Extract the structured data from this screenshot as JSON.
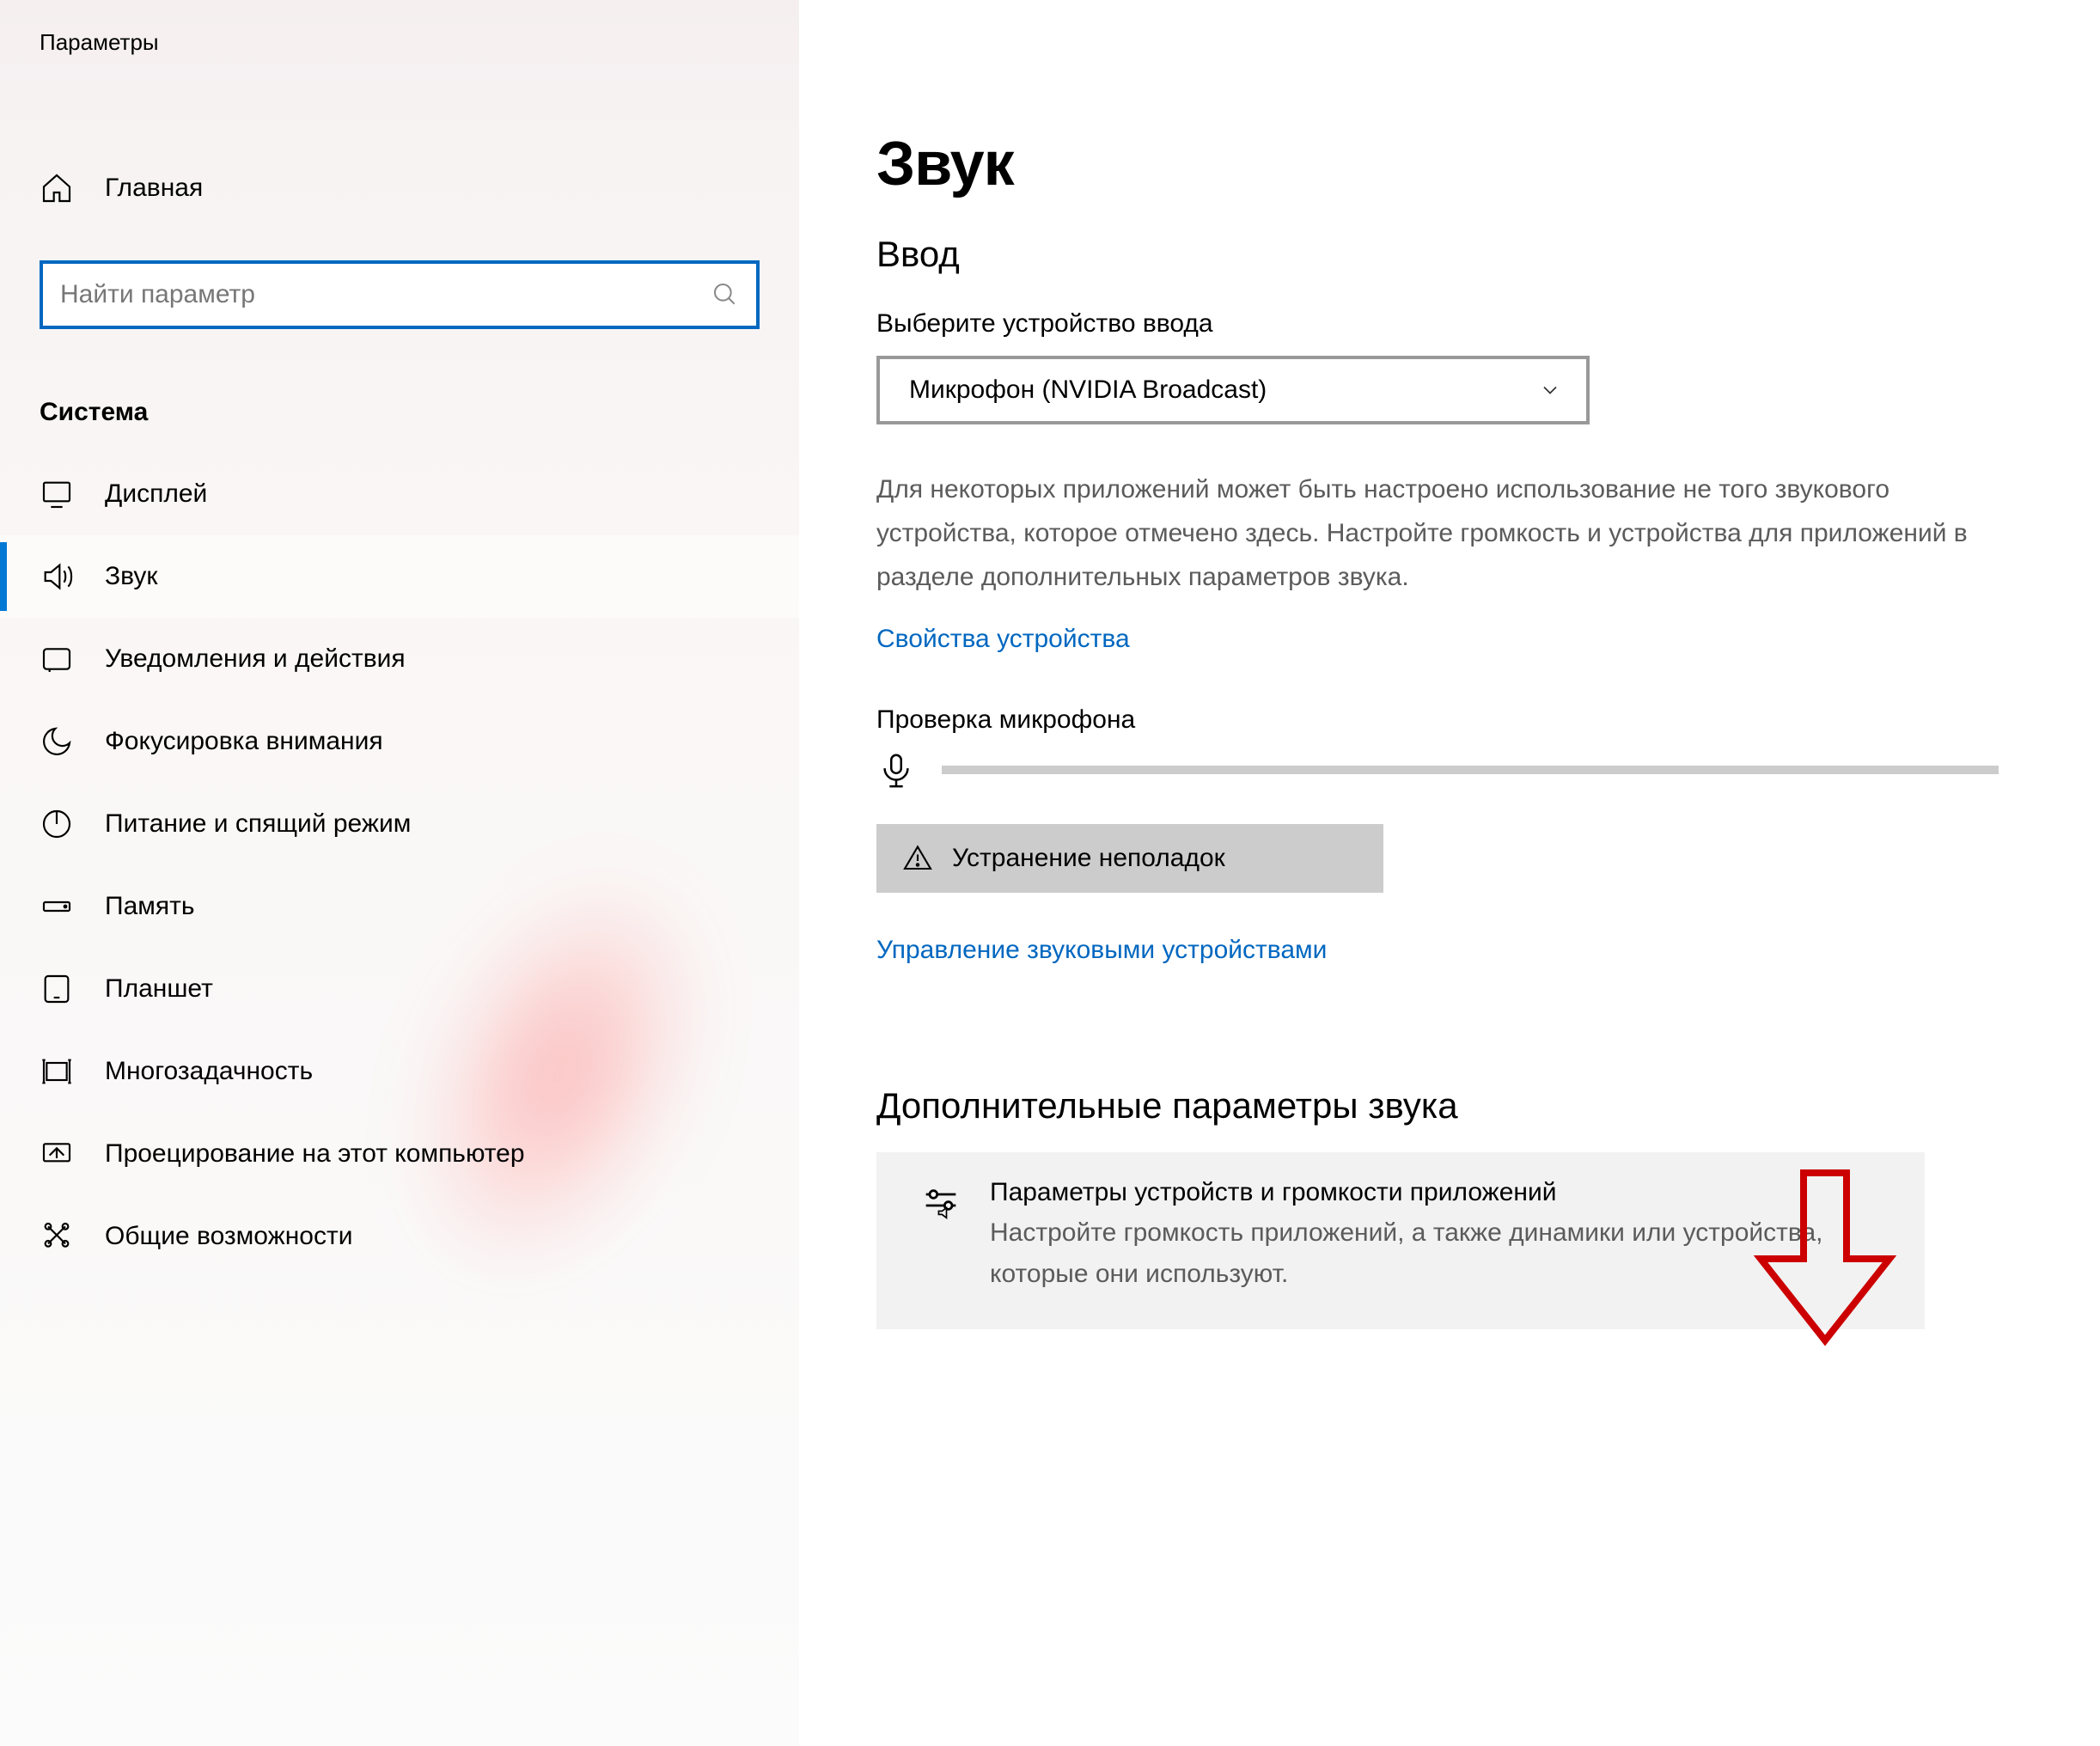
{
  "app_title": "Параметры",
  "sidebar": {
    "home_label": "Главная",
    "search_placeholder": "Найти параметр",
    "section_label": "Система",
    "items": [
      {
        "label": "Дисплей"
      },
      {
        "label": "Звук"
      },
      {
        "label": "Уведомления и действия"
      },
      {
        "label": "Фокусировка внимания"
      },
      {
        "label": "Питание и спящий режим"
      },
      {
        "label": "Память"
      },
      {
        "label": "Планшет"
      },
      {
        "label": "Многозадачность"
      },
      {
        "label": "Проецирование на этот компьютер"
      },
      {
        "label": "Общие возможности"
      }
    ]
  },
  "main": {
    "title": "Звук",
    "input_section": "Ввод",
    "choose_device_label": "Выберите устройство ввода",
    "device_selected": "Микрофон (NVIDIA Broadcast)",
    "help_text": "Для некоторых приложений может быть настроено использование не того звукового устройства, которое отмечено здесь. Настройте громкость и устройства для приложений в разделе дополнительных параметров звука.",
    "device_props_link": "Свойства устройства",
    "mic_test_label": "Проверка микрофона",
    "troubleshoot_label": "Устранение неполадок",
    "manage_devices_link": "Управление звуковыми устройствами",
    "adv_section": "Дополнительные параметры звука",
    "card": {
      "title": "Параметры устройств и громкости приложений",
      "desc": "Настройте громкость приложений, а также динамики или устройства, которые они используют."
    }
  }
}
